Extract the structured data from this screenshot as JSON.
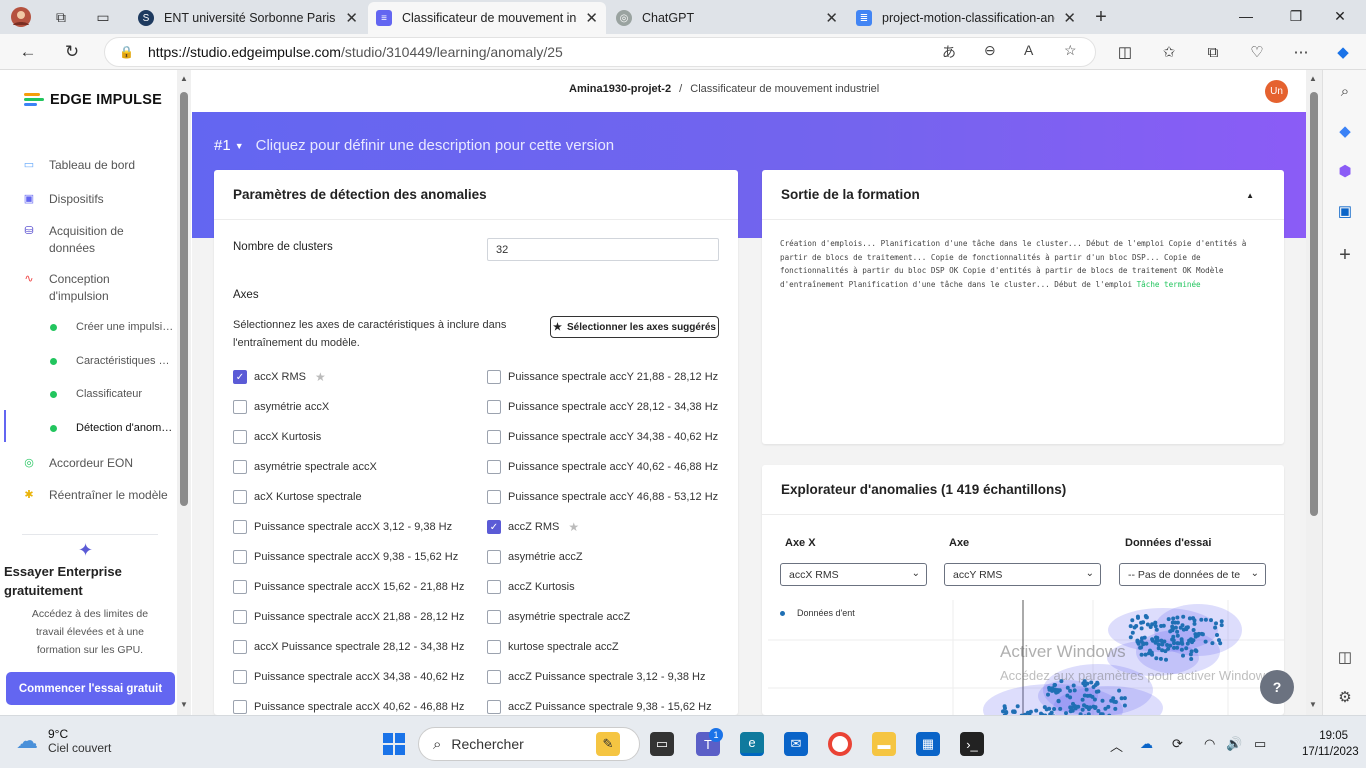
{
  "browser": {
    "tabs": [
      {
        "title": "ENT université Sorbonne Paris No",
        "icon": "S",
        "color": "#1e3a5f"
      },
      {
        "title": "Classificateur de mouvement ind",
        "icon": "≡",
        "color": "#6366f1"
      },
      {
        "title": "ChatGPT",
        "icon": "◎",
        "color": "#9aa3a0"
      },
      {
        "title": "project-motion-classification-anc",
        "icon": "≣",
        "color": "#4285f4"
      }
    ],
    "url_host": "https://studio.edgeimpulse.com",
    "url_path": "/studio/310449/learning/anomaly/25"
  },
  "sidebar": {
    "brand": "EDGE IMPULSE",
    "items": [
      {
        "label": "Tableau de bord",
        "icon": "monitor-icon"
      },
      {
        "label": "Dispositifs",
        "icon": "chip-icon"
      },
      {
        "label": "Acquisition de données",
        "icon": "database-icon"
      },
      {
        "label": "Conception d'impulsion",
        "icon": "pulse-icon"
      },
      {
        "label": "Accordeur EON",
        "icon": "eon-icon"
      },
      {
        "label": "Réentraîner le modèle",
        "icon": "retrain-icon"
      }
    ],
    "subitems": [
      {
        "label": "Créer une impulsion"
      },
      {
        "label": "Caractéristiques sp..."
      },
      {
        "label": "Classificateur"
      },
      {
        "label": "Détection d'anomal..."
      }
    ],
    "enterprise_title": "Essayer Enterprise gratuitement",
    "enterprise_desc": "Accédez à des limites de travail élevées et à une formation sur les GPU.",
    "enterprise_button": "Commencer l'essai gratuit"
  },
  "header": {
    "project": "Amina1930-projet-2",
    "separator": "/",
    "page": "Classificateur de mouvement industriel",
    "avatar": "Un"
  },
  "hero": {
    "version": "#1",
    "description": "Cliquez pour définir une description pour cette version"
  },
  "params": {
    "title": "Paramètres de détection des anomalies",
    "clusters_label": "Nombre de clusters",
    "clusters_value": "32",
    "axes_label": "Axes",
    "axes_desc": "Sélectionnez les axes de caractéristiques à inclure dans l'entraînement du modèle.",
    "suggest_button": "Sélectionner les axes suggérés",
    "left_axes": [
      {
        "label": "accX RMS",
        "checked": true,
        "star": true
      },
      {
        "label": "asymétrie accX",
        "checked": false
      },
      {
        "label": "accX Kurtosis",
        "checked": false
      },
      {
        "label": "asymétrie spectrale accX",
        "checked": false
      },
      {
        "label": "acX Kurtose spectrale",
        "checked": false
      },
      {
        "label": "Puissance spectrale accX 3,12 - 9,38 Hz",
        "checked": false
      },
      {
        "label": "Puissance spectrale accX 9,38 - 15,62 Hz",
        "checked": false
      },
      {
        "label": "Puissance spectrale accX 15,62 - 21,88 Hz",
        "checked": false
      },
      {
        "label": "Puissance spectrale accX 21,88 - 28,12 Hz",
        "checked": false
      },
      {
        "label": "accX Puissance spectrale 28,12 - 34,38 Hz",
        "checked": false
      },
      {
        "label": "Puissance spectrale accX 34,38 - 40,62 Hz",
        "checked": false
      },
      {
        "label": "Puissance spectrale accX 40,62 - 46,88 Hz",
        "checked": false
      }
    ],
    "right_axes": [
      {
        "label": "Puissance spectrale accY 21,88 - 28,12 Hz",
        "checked": false
      },
      {
        "label": "Puissance spectrale accY 28,12 - 34,38 Hz",
        "checked": false
      },
      {
        "label": "Puissance spectrale accY 34,38 - 40,62 Hz",
        "checked": false
      },
      {
        "label": "Puissance spectrale accY 40,62 - 46,88 Hz",
        "checked": false
      },
      {
        "label": "Puissance spectrale accY 46,88 - 53,12 Hz",
        "checked": false
      },
      {
        "label": "accZ RMS",
        "checked": true,
        "star": true
      },
      {
        "label": "asymétrie accZ",
        "checked": false
      },
      {
        "label": "accZ Kurtosis",
        "checked": false
      },
      {
        "label": "asymétrie spectrale accZ",
        "checked": false
      },
      {
        "label": "kurtose spectrale accZ",
        "checked": false
      },
      {
        "label": "accZ Puissance spectrale 3,12 - 9,38 Hz",
        "checked": false
      },
      {
        "label": "accZ Puissance spectrale 9,38 - 15,62 Hz",
        "checked": false
      }
    ]
  },
  "output": {
    "title": "Sortie de la formation",
    "log": "Création d'emplois... Planification d'une tâche dans le cluster... Début de l'emploi Copie d'entités à partir de blocs de traitement... Copie de fonctionnalités à partir d'un bloc DSP... Copie de fonctionnalités à partir du bloc DSP OK Copie d'entités à partir de blocs de traitement OK Modèle d'entraînement Planification d'une tâche dans le cluster... Début de l'emploi ",
    "done": "Tâche terminée"
  },
  "explorer": {
    "title": "Explorateur d'anomalies (1 419 échantillons)",
    "x_axis_label": "Axe X",
    "y_axis_label": "Axe",
    "test_label": "Données d'essai",
    "x_axis_value": "accX RMS",
    "y_axis_value": "accY RMS",
    "test_value": "-- Pas de données de te",
    "legend": "Données d'ent"
  },
  "overlay": {
    "watermark_title": "Activer Windows",
    "watermark_sub": "Accédez aux paramètres pour activer Windows.",
    "help": "?"
  },
  "taskbar": {
    "temperature": "9°C",
    "weather": "Ciel couvert",
    "search": "Rechercher",
    "badge": "1",
    "time": "19:05",
    "date": "17/11/2023"
  }
}
